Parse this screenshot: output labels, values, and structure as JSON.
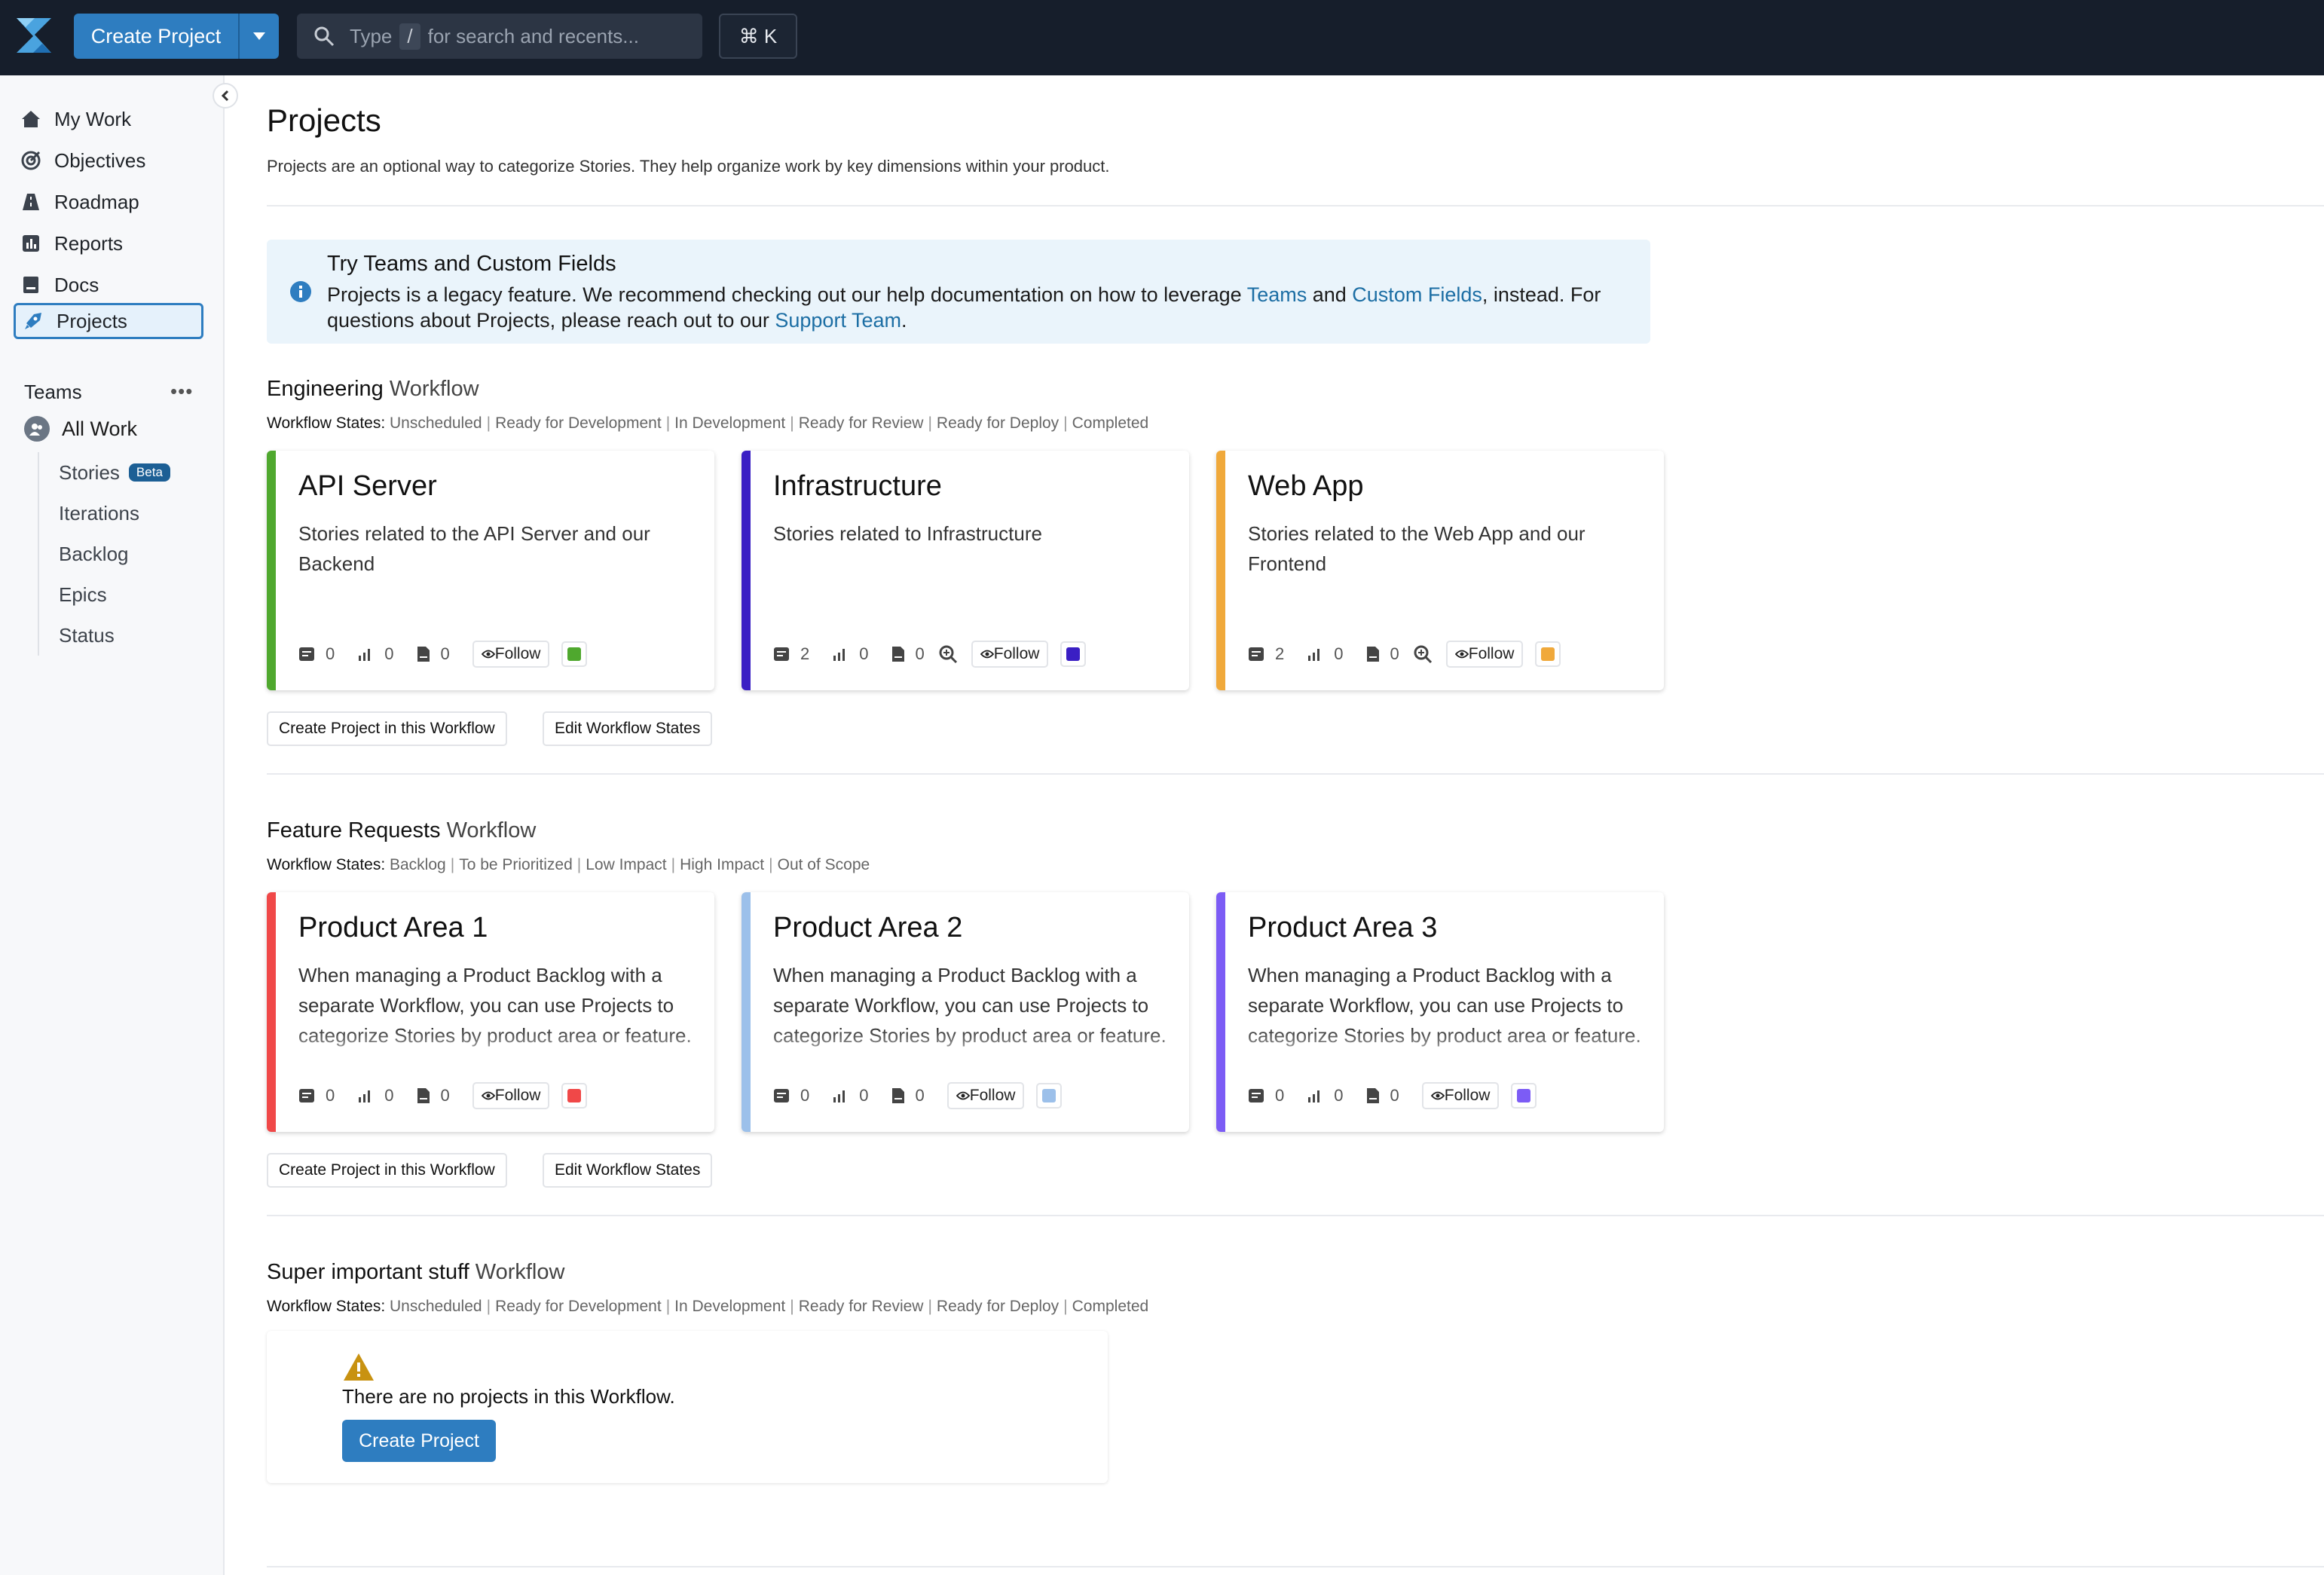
{
  "topbar": {
    "create_label": "Create Project",
    "search_prefix": "Type",
    "search_slash": "/",
    "search_placeholder": "for search and recents...",
    "shortcut": "⌘ K"
  },
  "sidebar": {
    "items": [
      {
        "label": "My Work",
        "icon": "home-icon"
      },
      {
        "label": "Objectives",
        "icon": "target-icon"
      },
      {
        "label": "Roadmap",
        "icon": "roadmap-icon"
      },
      {
        "label": "Reports",
        "icon": "chart-icon"
      },
      {
        "label": "Docs",
        "icon": "doc-icon"
      },
      {
        "label": "Projects",
        "icon": "rocket-icon",
        "active": true
      }
    ],
    "teams_label": "Teams",
    "teams_more": "•••",
    "all_work": "All Work",
    "sub_items": [
      "Stories",
      "Iterations",
      "Backlog",
      "Epics",
      "Status"
    ],
    "beta": "Beta"
  },
  "page": {
    "title": "Projects",
    "description": "Projects are an optional way to categorize Stories. They help organize work by key dimensions within your product."
  },
  "info": {
    "title": "Try Teams and Custom Fields",
    "text1": "Projects is a legacy feature. We recommend checking out our help documentation on how to leverage ",
    "link1": "Teams",
    "text2": " and ",
    "link2": "Custom Fields",
    "text3": ", instead. For questions about Projects, please reach out to our ",
    "link3": "Support Team",
    "text4": "."
  },
  "workflow_word": "Workflow",
  "states_label": "Workflow States:",
  "follow_label": "Follow",
  "buttons": {
    "create_in_workflow": "Create Project in this Workflow",
    "edit_states": "Edit Workflow States"
  },
  "workflows": [
    {
      "name": "Engineering",
      "states": [
        "Unscheduled",
        "Ready for Development",
        "In Development",
        "Ready for Review",
        "Ready for Deploy",
        "Completed"
      ],
      "projects": [
        {
          "name": "API Server",
          "description": "Stories related to the API Server and our Backend",
          "color": "#4fa82e",
          "stories": "0",
          "points": "0",
          "docs": "0",
          "zoom": false
        },
        {
          "name": "Infrastructure",
          "description": "Stories related to Infrastructure",
          "color": "#3a1fc4",
          "stories": "2",
          "points": "0",
          "docs": "0",
          "zoom": true
        },
        {
          "name": "Web App",
          "description": "Stories related to the Web App and our Frontend",
          "color": "#f0a93b",
          "stories": "2",
          "points": "0",
          "docs": "0",
          "zoom": true
        }
      ]
    },
    {
      "name": "Feature Requests",
      "states": [
        "Backlog",
        "To be Prioritized",
        "Low Impact",
        "High Impact",
        "Out of Scope"
      ],
      "projects": [
        {
          "name": "Product Area 1",
          "description": "When managing a Product Backlog with a separate Workflow, you can use Projects to categorize Stories by product area or feature.",
          "color": "#f04848",
          "stories": "0",
          "points": "0",
          "docs": "0",
          "zoom": false
        },
        {
          "name": "Product Area 2",
          "description": "When managing a Product Backlog with a separate Workflow, you can use Projects to categorize Stories by product area or feature.",
          "color": "#9cc0ea",
          "stories": "0",
          "points": "0",
          "docs": "0",
          "zoom": false
        },
        {
          "name": "Product Area 3",
          "description": "When managing a Product Backlog with a separate Workflow, you can use Projects to categorize Stories by product area or feature.",
          "color": "#7c5cf5",
          "stories": "0",
          "points": "0",
          "docs": "0",
          "zoom": false
        }
      ]
    },
    {
      "name": "Super important stuff",
      "states": [
        "Unscheduled",
        "Ready for Development",
        "In Development",
        "Ready for Review",
        "Ready for Deploy",
        "Completed"
      ],
      "projects": []
    }
  ],
  "empty": {
    "message": "There are no projects in this Workflow.",
    "button": "Create Project"
  }
}
